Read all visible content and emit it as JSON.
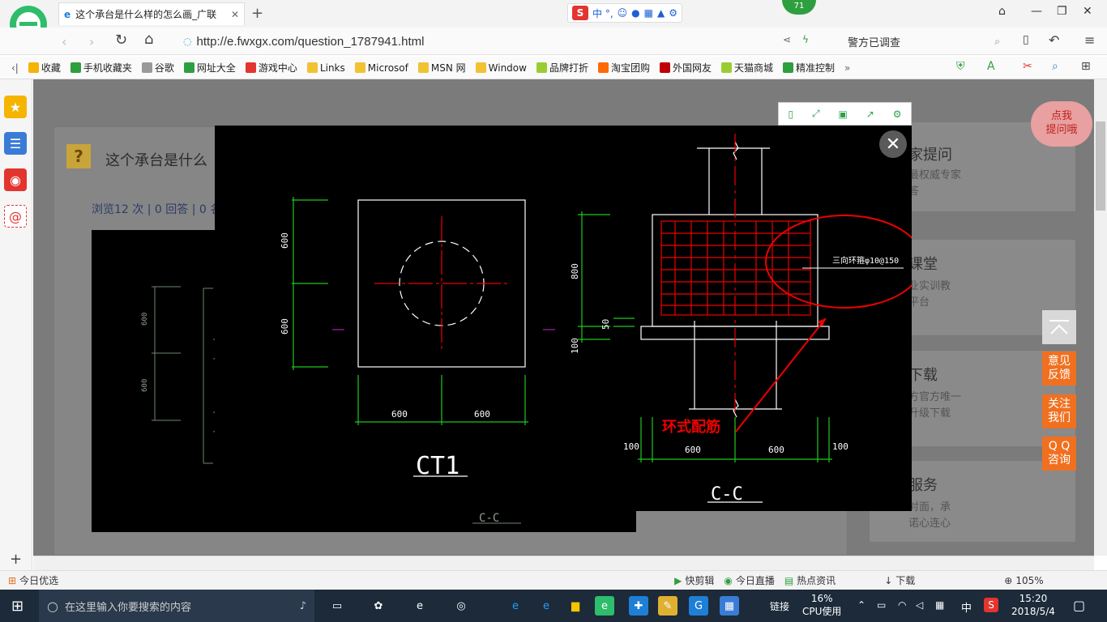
{
  "browser": {
    "tab_title": "这个承台是什么样的怎么画_广联",
    "new_tab_symbol": "+",
    "url": "http://e.fwxgx.com/question_1787941.html",
    "search_text": "警方已调查",
    "badge": "71",
    "sogou_label": "中 °,"
  },
  "bookmarks": [
    {
      "label": "收藏",
      "color": "#f5b400"
    },
    {
      "label": "手机收藏夹",
      "color": "#2e9f3e"
    },
    {
      "label": "谷歌",
      "color": "#999999"
    },
    {
      "label": "网址大全",
      "color": "#2e9f3e"
    },
    {
      "label": "游戏中心",
      "color": "#e3342f"
    },
    {
      "label": "Links",
      "color": "#f1c232"
    },
    {
      "label": "Microsof",
      "color": "#f1c232"
    },
    {
      "label": "MSN 网",
      "color": "#f1c232"
    },
    {
      "label": "Window",
      "color": "#f1c232"
    },
    {
      "label": "品牌打折",
      "color": "#9acd32"
    },
    {
      "label": "淘宝团购",
      "color": "#ff6a00"
    },
    {
      "label": "外国网友",
      "color": "#c00000"
    },
    {
      "label": "天猫商城",
      "color": "#9acd32"
    },
    {
      "label": "精准控制",
      "color": "#2e9f3e"
    }
  ],
  "page": {
    "question_title": "这个承台是什么",
    "stats": "浏览12 次 | 0 回答 | 0 名",
    "right_cards": [
      {
        "title": "家提问",
        "sub1": "最权威专家",
        "sub2": "答"
      },
      {
        "title": "课堂",
        "sub1": "业实训教",
        "sub2": "平台"
      },
      {
        "title": "下载",
        "sub1": "方官方唯一",
        "sub2": "升级下载"
      },
      {
        "title": "服务",
        "sub1": "对面，承",
        "sub2": "诺心连心"
      }
    ],
    "help_bubble": "点我\n提问哦",
    "side_buttons": [
      "意见\n反馈",
      "关注\n我们",
      "Q Q\n咨询"
    ]
  },
  "cad": {
    "left_dim_600_top": "600",
    "left_dim_600_bottom": "600",
    "bottom_dim_left": "600",
    "bottom_dim_right": "600",
    "ct_label": "CT1",
    "section_label": "C-C",
    "dim_800": "800",
    "dim_50": "50",
    "dim_100_vert": "100",
    "bot_100_left": "100",
    "bot_600_left": "600",
    "bot_600_right": "600",
    "bot_100_right": "100",
    "rebar_note": "三向环箍φ10@150",
    "annotation": "环式配筋",
    "back_dim_600a": "600",
    "back_dim_600b": "600",
    "back_label": "C-C"
  },
  "statusbar": {
    "left": "今日优选",
    "items": [
      "快剪辑",
      "今日直播",
      "热点资讯"
    ],
    "download": "下载",
    "zoom": "105%"
  },
  "taskbar": {
    "search_placeholder": "在这里输入你要搜索的内容",
    "link_label": "链接",
    "cpu_percent": "16%",
    "cpu_label": "CPU使用",
    "ime": "中",
    "time": "15:20",
    "date": "2018/5/4"
  }
}
